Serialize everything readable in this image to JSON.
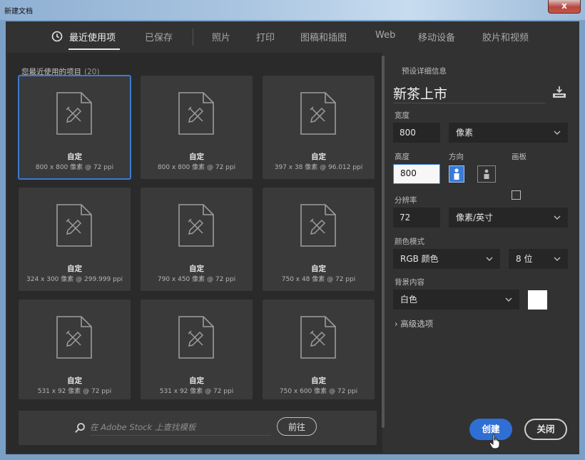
{
  "window": {
    "title": "新建文档",
    "close_label": "x"
  },
  "tabs": [
    {
      "label": "最近使用项",
      "active": true
    },
    {
      "label": "已保存"
    },
    {
      "label": "照片"
    },
    {
      "label": "打印"
    },
    {
      "label": "图稿和插图"
    },
    {
      "label": "Web"
    },
    {
      "label": "移动设备"
    },
    {
      "label": "胶片和视频"
    }
  ],
  "recent": {
    "header": "您最近使用的项目",
    "count": "(20)",
    "items": [
      {
        "name": "自定",
        "size": "800 x 800 像素 @ 72 ppi",
        "selected": true
      },
      {
        "name": "自定",
        "size": "800 x 800 像素 @ 72 ppi"
      },
      {
        "name": "自定",
        "size": "397 x 38 像素 @ 96.012 ppi"
      },
      {
        "name": "自定",
        "size": "324 x 300 像素 @ 299.999 ppi"
      },
      {
        "name": "自定",
        "size": "790 x 450 像素 @ 72 ppi"
      },
      {
        "name": "自定",
        "size": "750 x 48 像素 @ 72 ppi"
      },
      {
        "name": "自定",
        "size": "531 x 92 像素 @ 72 ppi"
      },
      {
        "name": "自定",
        "size": "531 x 92 像素 @ 72 ppi"
      },
      {
        "name": "自定",
        "size": "750 x 600 像素 @ 72 ppi"
      }
    ]
  },
  "stock": {
    "placeholder": "在 Adobe Stock 上查找模板",
    "go_label": "前往"
  },
  "details": {
    "section_label": "预设详细信息",
    "preset_name": "新茶上市",
    "width_label": "宽度",
    "width_value": "800",
    "width_unit": "像素",
    "height_label": "高度",
    "height_value": "800",
    "orientation_label": "方向",
    "artboard_label": "画板",
    "resolution_label": "分辨率",
    "resolution_value": "72",
    "resolution_unit": "像素/英寸",
    "color_mode_label": "颜色模式",
    "color_mode": "RGB 颜色",
    "bit_depth": "8 位",
    "background_label": "背景内容",
    "background": "白色",
    "background_color": "#ffffff",
    "advanced_label": "高级选项"
  },
  "actions": {
    "create_label": "创建",
    "close_label": "关闭"
  },
  "colors": {
    "accent": "#3a7bd5",
    "panel": "#2a2a2a",
    "card": "#3a3a3a"
  }
}
